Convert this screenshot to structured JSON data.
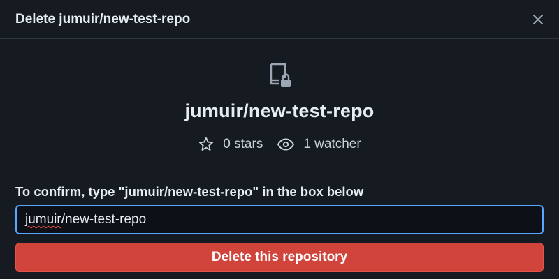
{
  "dialog": {
    "title": "Delete jumuir/new-test-repo",
    "close_icon": "close-icon"
  },
  "repo": {
    "icon": "repo-locked-icon",
    "name": "jumuir/new-test-repo",
    "stars_icon": "star-icon",
    "stars": "0 stars",
    "watchers_icon": "eye-icon",
    "watchers": "1 watcher"
  },
  "confirm": {
    "label": "To confirm, type \"jumuir/new-test-repo\" in the box below",
    "input_value_misspelled_part": "jumuir",
    "input_value_rest": "/new-test-repo",
    "button_label": "Delete this repository"
  },
  "colors": {
    "background": "#161b22",
    "border": "#30363d",
    "input_focus": "#58a6ff",
    "danger": "#d0443c"
  }
}
